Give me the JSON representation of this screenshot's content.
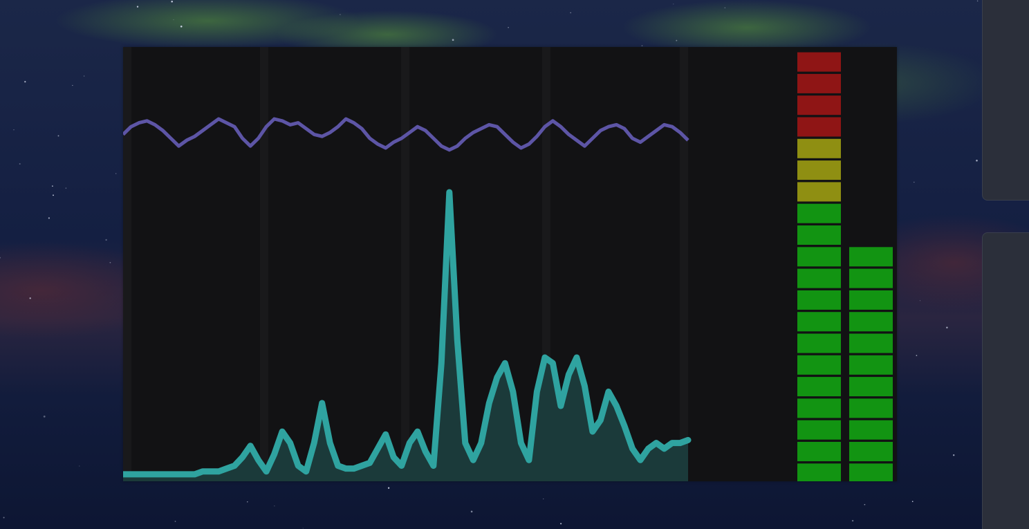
{
  "colors": {
    "sky_top": "#1a2545",
    "sky_mid": "#0f1a3a",
    "aurora": "#4f8a3a",
    "horizon_glow": "#4a2a3a",
    "panel_bg": "#121214",
    "column_shade": "#19191b",
    "waveform_line": "#5d55a6",
    "spectrum_edge": "#2fa3a0",
    "spectrum_fill": "#1b3a3a",
    "meter_red": "#8f1515",
    "meter_yellow": "#8f8f12",
    "meter_green": "#129412",
    "side_card": "#2b2f3a"
  },
  "chart_data": [
    {
      "type": "line",
      "name": "waveform",
      "ylim": [
        0,
        1
      ],
      "values": [
        0.62,
        0.66,
        0.68,
        0.69,
        0.67,
        0.64,
        0.6,
        0.56,
        0.59,
        0.61,
        0.64,
        0.67,
        0.7,
        0.68,
        0.66,
        0.6,
        0.56,
        0.6,
        0.66,
        0.7,
        0.69,
        0.67,
        0.68,
        0.65,
        0.62,
        0.61,
        0.63,
        0.66,
        0.7,
        0.68,
        0.65,
        0.6,
        0.57,
        0.55,
        0.58,
        0.6,
        0.63,
        0.66,
        0.64,
        0.6,
        0.56,
        0.54,
        0.56,
        0.6,
        0.63,
        0.65,
        0.67,
        0.66,
        0.62,
        0.58,
        0.55,
        0.57,
        0.61,
        0.66,
        0.69,
        0.66,
        0.62,
        0.59,
        0.56,
        0.6,
        0.64,
        0.66,
        0.67,
        0.65,
        0.6,
        0.58,
        0.61,
        0.64,
        0.67,
        0.66,
        0.63,
        0.59
      ]
    },
    {
      "type": "area",
      "name": "spectrum",
      "ylim": [
        0,
        1
      ],
      "values": [
        0.01,
        0.01,
        0.01,
        0.01,
        0.01,
        0.01,
        0.01,
        0.01,
        0.01,
        0.01,
        0.02,
        0.02,
        0.02,
        0.03,
        0.04,
        0.07,
        0.11,
        0.06,
        0.02,
        0.08,
        0.16,
        0.12,
        0.04,
        0.02,
        0.12,
        0.26,
        0.12,
        0.04,
        0.03,
        0.03,
        0.04,
        0.05,
        0.1,
        0.15,
        0.07,
        0.04,
        0.12,
        0.16,
        0.09,
        0.04,
        0.4,
        1.0,
        0.48,
        0.12,
        0.06,
        0.12,
        0.26,
        0.35,
        0.4,
        0.3,
        0.12,
        0.06,
        0.3,
        0.42,
        0.4,
        0.25,
        0.36,
        0.42,
        0.32,
        0.16,
        0.2,
        0.3,
        0.25,
        0.18,
        0.1,
        0.06,
        0.1,
        0.12,
        0.1,
        0.12,
        0.12,
        0.13
      ]
    },
    {
      "type": "bar",
      "name": "level-meters",
      "segments": 20,
      "red_segments": 4,
      "yellow_segments": 3,
      "values": [
        1.0,
        0.55
      ]
    }
  ]
}
